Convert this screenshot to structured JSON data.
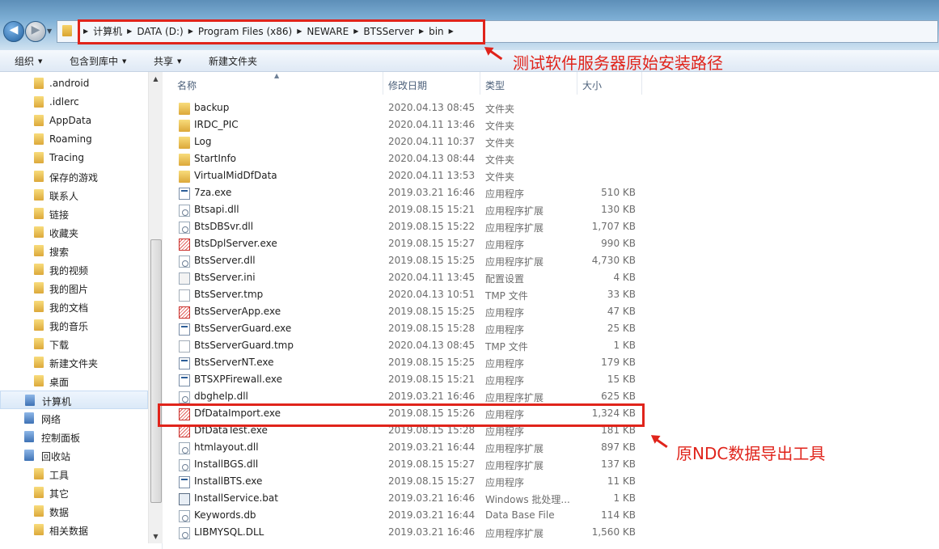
{
  "address": {
    "crumbs": [
      "计算机",
      "DATA (D:)",
      "Program Files (x86)",
      "NEWARE",
      "BTSServer",
      "bin"
    ]
  },
  "toolbar": {
    "organize": "组织",
    "include_library": "包含到库中",
    "share": "共享",
    "new_folder": "新建文件夹"
  },
  "columns": {
    "name": "名称",
    "date": "修改日期",
    "type": "类型",
    "size": "大小"
  },
  "sidebar": {
    "items": [
      {
        "label": ".android",
        "icon": "folder-icon"
      },
      {
        "label": ".idlerc",
        "icon": "folder-icon"
      },
      {
        "label": "AppData",
        "icon": "folder-icon"
      },
      {
        "label": "Roaming",
        "icon": "folder-icon"
      },
      {
        "label": "Tracing",
        "icon": "folder-icon"
      },
      {
        "label": "保存的游戏",
        "icon": "folder-icon"
      },
      {
        "label": "联系人",
        "icon": "folder-icon"
      },
      {
        "label": "链接",
        "icon": "folder-icon"
      },
      {
        "label": "收藏夹",
        "icon": "folder-icon"
      },
      {
        "label": "搜索",
        "icon": "folder-icon"
      },
      {
        "label": "我的视频",
        "icon": "folder-icon"
      },
      {
        "label": "我的图片",
        "icon": "folder-icon"
      },
      {
        "label": "我的文档",
        "icon": "folder-icon"
      },
      {
        "label": "我的音乐",
        "icon": "folder-icon"
      },
      {
        "label": "下载",
        "icon": "folder-icon"
      },
      {
        "label": "新建文件夹",
        "icon": "folder-icon"
      },
      {
        "label": "桌面",
        "icon": "folder-icon"
      },
      {
        "label": "计算机",
        "icon": "computer-icon"
      },
      {
        "label": "网络",
        "icon": "network-icon"
      },
      {
        "label": "控制面板",
        "icon": "control-panel-icon"
      },
      {
        "label": "回收站",
        "icon": "recycle-bin-icon"
      },
      {
        "label": "工具",
        "icon": "folder-icon"
      },
      {
        "label": "其它",
        "icon": "folder-icon"
      },
      {
        "label": "数据",
        "icon": "folder-icon"
      },
      {
        "label": "相关数据",
        "icon": "folder-icon"
      }
    ]
  },
  "files": [
    {
      "name": "backup",
      "date": "2020.04.13 08:45",
      "type": "文件夹",
      "size": "",
      "icon": "folder"
    },
    {
      "name": "IRDC_PIC",
      "date": "2020.04.11 13:46",
      "type": "文件夹",
      "size": "",
      "icon": "folder"
    },
    {
      "name": "Log",
      "date": "2020.04.11 10:37",
      "type": "文件夹",
      "size": "",
      "icon": "folder"
    },
    {
      "name": "StartInfo",
      "date": "2020.04.13 08:44",
      "type": "文件夹",
      "size": "",
      "icon": "folder"
    },
    {
      "name": "VirtualMidDfData",
      "date": "2020.04.11 13:53",
      "type": "文件夹",
      "size": "",
      "icon": "folder"
    },
    {
      "name": "7za.exe",
      "date": "2019.03.21 16:46",
      "type": "应用程序",
      "size": "510 KB",
      "icon": "exe"
    },
    {
      "name": "Btsapi.dll",
      "date": "2019.08.15 15:21",
      "type": "应用程序扩展",
      "size": "130 KB",
      "icon": "dll"
    },
    {
      "name": "BtsDBSvr.dll",
      "date": "2019.08.15 15:22",
      "type": "应用程序扩展",
      "size": "1,707 KB",
      "icon": "dll"
    },
    {
      "name": "BtsDplServer.exe",
      "date": "2019.08.15 15:27",
      "type": "应用程序",
      "size": "990 KB",
      "icon": "redexe"
    },
    {
      "name": "BtsServer.dll",
      "date": "2019.08.15 15:25",
      "type": "应用程序扩展",
      "size": "4,730 KB",
      "icon": "dll"
    },
    {
      "name": "BtsServer.ini",
      "date": "2020.04.11 13:45",
      "type": "配置设置",
      "size": "4 KB",
      "icon": "ini"
    },
    {
      "name": "BtsServer.tmp",
      "date": "2020.04.13 10:51",
      "type": "TMP 文件",
      "size": "33 KB",
      "icon": "doc"
    },
    {
      "name": "BtsServerApp.exe",
      "date": "2019.08.15 15:25",
      "type": "应用程序",
      "size": "47 KB",
      "icon": "redexe"
    },
    {
      "name": "BtsServerGuard.exe",
      "date": "2019.08.15 15:28",
      "type": "应用程序",
      "size": "25 KB",
      "icon": "exe"
    },
    {
      "name": "BtsServerGuard.tmp",
      "date": "2020.04.13 08:45",
      "type": "TMP 文件",
      "size": "1 KB",
      "icon": "doc"
    },
    {
      "name": "BtsServerNT.exe",
      "date": "2019.08.15 15:25",
      "type": "应用程序",
      "size": "179 KB",
      "icon": "exe"
    },
    {
      "name": "BTSXPFirewall.exe",
      "date": "2019.08.15 15:21",
      "type": "应用程序",
      "size": "15 KB",
      "icon": "exe"
    },
    {
      "name": "dbghelp.dll",
      "date": "2019.03.21 16:46",
      "type": "应用程序扩展",
      "size": "625 KB",
      "icon": "dll"
    },
    {
      "name": "DfDataImport.exe",
      "date": "2019.08.15 15:26",
      "type": "应用程序",
      "size": "1,324 KB",
      "icon": "redexe"
    },
    {
      "name": "DfDataTest.exe",
      "date": "2019.08.15 15:28",
      "type": "应用程序",
      "size": "181 KB",
      "icon": "redexe"
    },
    {
      "name": "htmlayout.dll",
      "date": "2019.03.21 16:44",
      "type": "应用程序扩展",
      "size": "897 KB",
      "icon": "dll"
    },
    {
      "name": "InstallBGS.dll",
      "date": "2019.08.15 15:27",
      "type": "应用程序扩展",
      "size": "137 KB",
      "icon": "dll"
    },
    {
      "name": "InstallBTS.exe",
      "date": "2019.08.15 15:27",
      "type": "应用程序",
      "size": "11 KB",
      "icon": "exe"
    },
    {
      "name": "InstallService.bat",
      "date": "2019.03.21 16:46",
      "type": "Windows 批处理...",
      "size": "1 KB",
      "icon": "bat"
    },
    {
      "name": "Keywords.db",
      "date": "2019.03.21 16:44",
      "type": "Data Base File",
      "size": "114 KB",
      "icon": "dll"
    },
    {
      "name": "LIBMYSQL.DLL",
      "date": "2019.03.21 16:46",
      "type": "应用程序扩展",
      "size": "1,560 KB",
      "icon": "dll"
    }
  ],
  "annotations": {
    "path_note": "测试软件服务器原始安装路径",
    "tool_note": "原NDC数据导出工具"
  },
  "colors": {
    "annotation_red": "#e0241b",
    "title_bar_blue": "#5d8fb8"
  }
}
